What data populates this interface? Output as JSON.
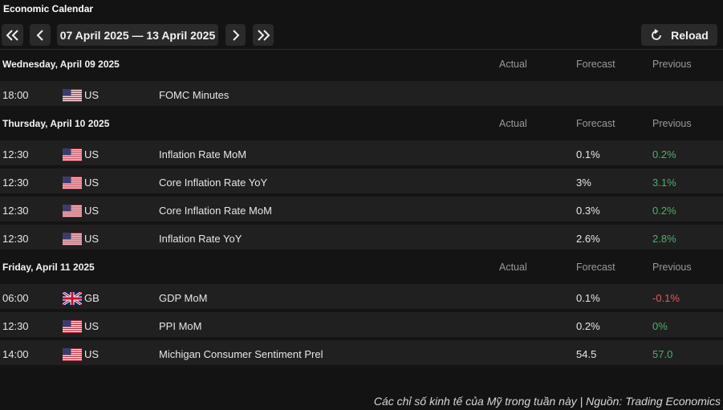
{
  "app": {
    "title": "Economic Calendar"
  },
  "toolbar": {
    "date_range": "07 April 2025 — 13 April 2025",
    "reload_label": "Reload"
  },
  "columns": {
    "actual": "Actual",
    "forecast": "Forecast",
    "previous": "Previous"
  },
  "colors": {
    "up": "#4caf6a",
    "down": "#e05a5a",
    "neutral": "#e6e6e6"
  },
  "sections": [
    {
      "day": "Wednesday, April 09 2025",
      "events": [
        {
          "time": "18:00",
          "flag": "us-flag-icon",
          "country": "US",
          "event": "FOMC Minutes",
          "actual": "",
          "forecast": "",
          "previous": "",
          "trend": "neutral"
        }
      ]
    },
    {
      "day": "Thursday, April 10 2025",
      "events": [
        {
          "time": "12:30",
          "flag": "us-flag-icon",
          "country": "US",
          "event": "Inflation Rate MoM",
          "actual": "",
          "forecast": "0.1%",
          "previous": "0.2%",
          "trend": "up"
        },
        {
          "time": "12:30",
          "flag": "us-flag-icon",
          "country": "US",
          "event": "Core Inflation Rate YoY",
          "actual": "",
          "forecast": "3%",
          "previous": "3.1%",
          "trend": "up"
        },
        {
          "time": "12:30",
          "flag": "us-flag-icon",
          "country": "US",
          "event": "Core Inflation Rate MoM",
          "actual": "",
          "forecast": "0.3%",
          "previous": "0.2%",
          "trend": "up"
        },
        {
          "time": "12:30",
          "flag": "us-flag-icon",
          "country": "US",
          "event": "Inflation Rate YoY",
          "actual": "",
          "forecast": "2.6%",
          "previous": "2.8%",
          "trend": "up"
        }
      ]
    },
    {
      "day": "Friday, April 11 2025",
      "events": [
        {
          "time": "06:00",
          "flag": "gb-flag-icon",
          "country": "GB",
          "event": "GDP MoM",
          "actual": "",
          "forecast": "0.1%",
          "previous": "-0.1%",
          "trend": "down"
        },
        {
          "time": "12:30",
          "flag": "us-flag-icon",
          "country": "US",
          "event": "PPI MoM",
          "actual": "",
          "forecast": "0.2%",
          "previous": "0%",
          "trend": "up"
        },
        {
          "time": "14:00",
          "flag": "us-flag-icon",
          "country": "US",
          "event": "Michigan Consumer Sentiment Prel",
          "actual": "",
          "forecast": "54.5",
          "previous": "57.0",
          "trend": "up"
        }
      ]
    }
  ],
  "caption": "Các chỉ số kinh tế của Mỹ trong tuần này | Nguồn: Trading Economics"
}
